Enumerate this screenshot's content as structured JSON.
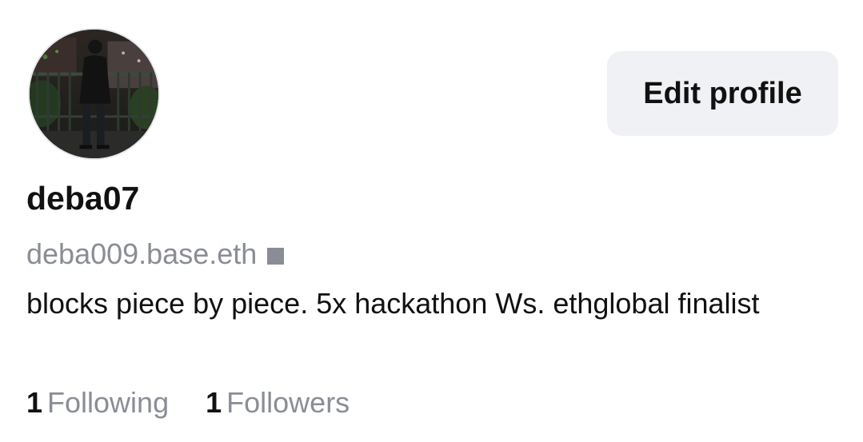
{
  "profile": {
    "display_name": "deba07",
    "handle": "deba009.base.eth",
    "bio": "blocks piece by piece. 5x hackathon Ws. ethglobal finalist",
    "edit_label": "Edit profile",
    "avatar_icon": "profile-photo",
    "badge_icon": "verified-square-icon"
  },
  "stats": {
    "following_count": "1",
    "following_label": "Following",
    "followers_count": "1",
    "followers_label": "Followers"
  },
  "colors": {
    "text_primary": "#111111",
    "text_secondary": "#8a8d96",
    "button_bg": "#f0f1f4",
    "background": "#ffffff"
  }
}
